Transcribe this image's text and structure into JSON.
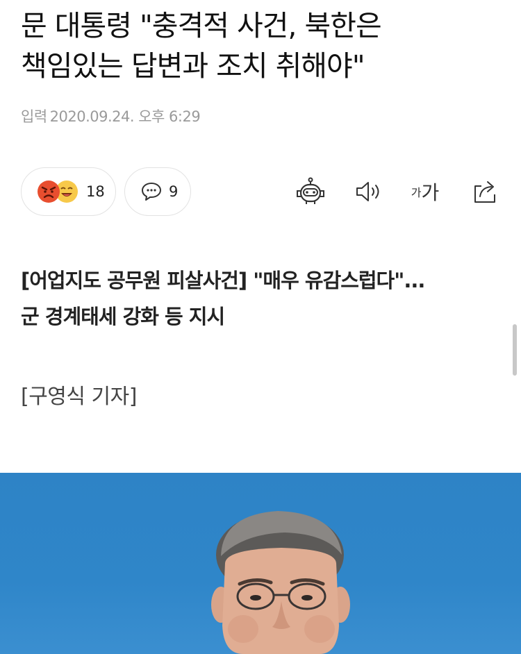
{
  "article": {
    "headline_line1": "문 대통령 \"충격적 사건, 북한은",
    "headline_line2": "책임있는 답변과 조치 취해야\"",
    "date_label": "입력",
    "date_value": "2020.09.24. 오후 6:29",
    "subhead_line1": "[어업지도 공무원 피살사건] \"매우 유감스럽다\"...",
    "subhead_line2": "군 경계태세 강화 등 지시",
    "byline": "[구영식 기자]"
  },
  "actions": {
    "reaction_count": "18",
    "comment_count": "9",
    "font_size_small": "가",
    "font_size_big": "가",
    "icons": [
      "angry-face-icon",
      "laughing-face-icon",
      "speech-bubble-icon",
      "robot-icon",
      "speaker-icon",
      "font-size-icon",
      "share-icon"
    ]
  },
  "colors": {
    "photo_background": "#2f86c9",
    "date_text": "#9a9a9a",
    "angry_face": "#e84e2f",
    "laugh_face": "#f7c94a"
  }
}
